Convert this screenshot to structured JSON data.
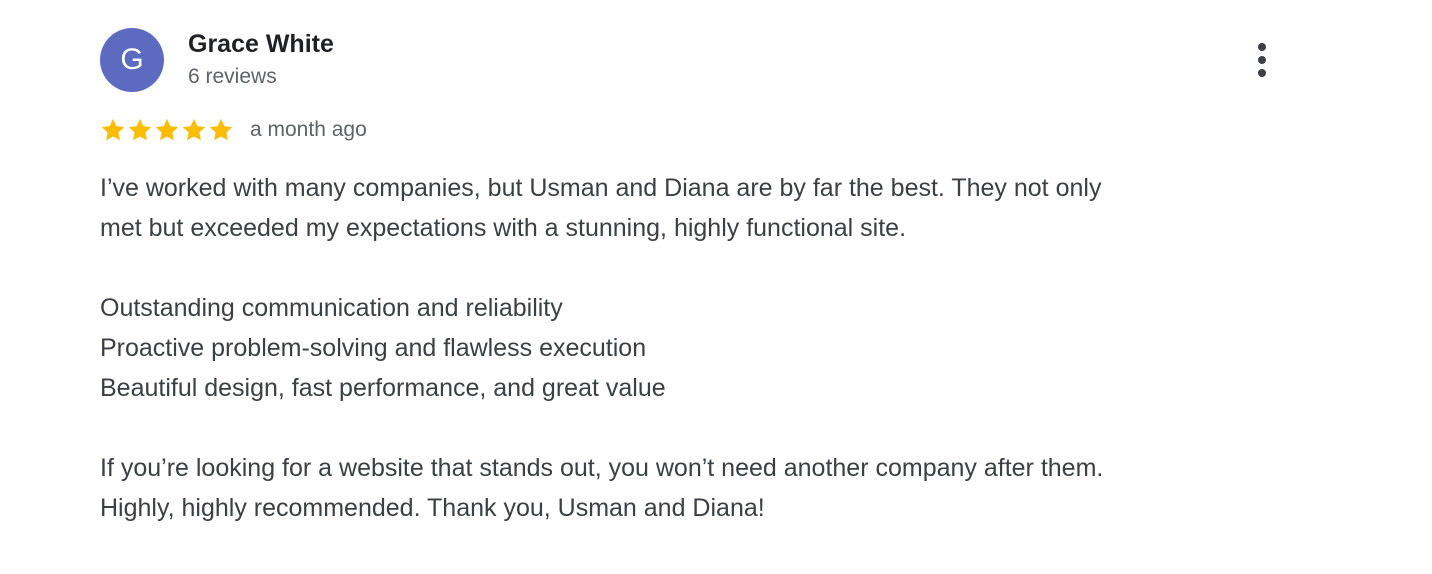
{
  "review": {
    "author": {
      "initial": "G",
      "name": "Grace White",
      "review_count": "6 reviews",
      "avatar_color": "#5c6bc0"
    },
    "rating": {
      "stars": 5,
      "max_stars": 5,
      "star_color": "#fbbc04"
    },
    "time_ago": "a month ago",
    "more_icon": "more-vert-icon",
    "body": {
      "para1_line1": "I’ve worked with many companies, but Usman and Diana are by far the best. They not only",
      "para1_line2": "met but exceeded my expectations with a stunning, highly functional site.",
      "point1": "Outstanding communication and reliability",
      "point2": "Proactive problem-solving and flawless execution",
      "point3": "Beautiful design, fast performance, and great value",
      "para3_line1": "If you’re looking for a website that stands out, you won’t need another company after them.",
      "para3_line2": "Highly, highly recommended. Thank you, Usman and Diana!"
    }
  }
}
